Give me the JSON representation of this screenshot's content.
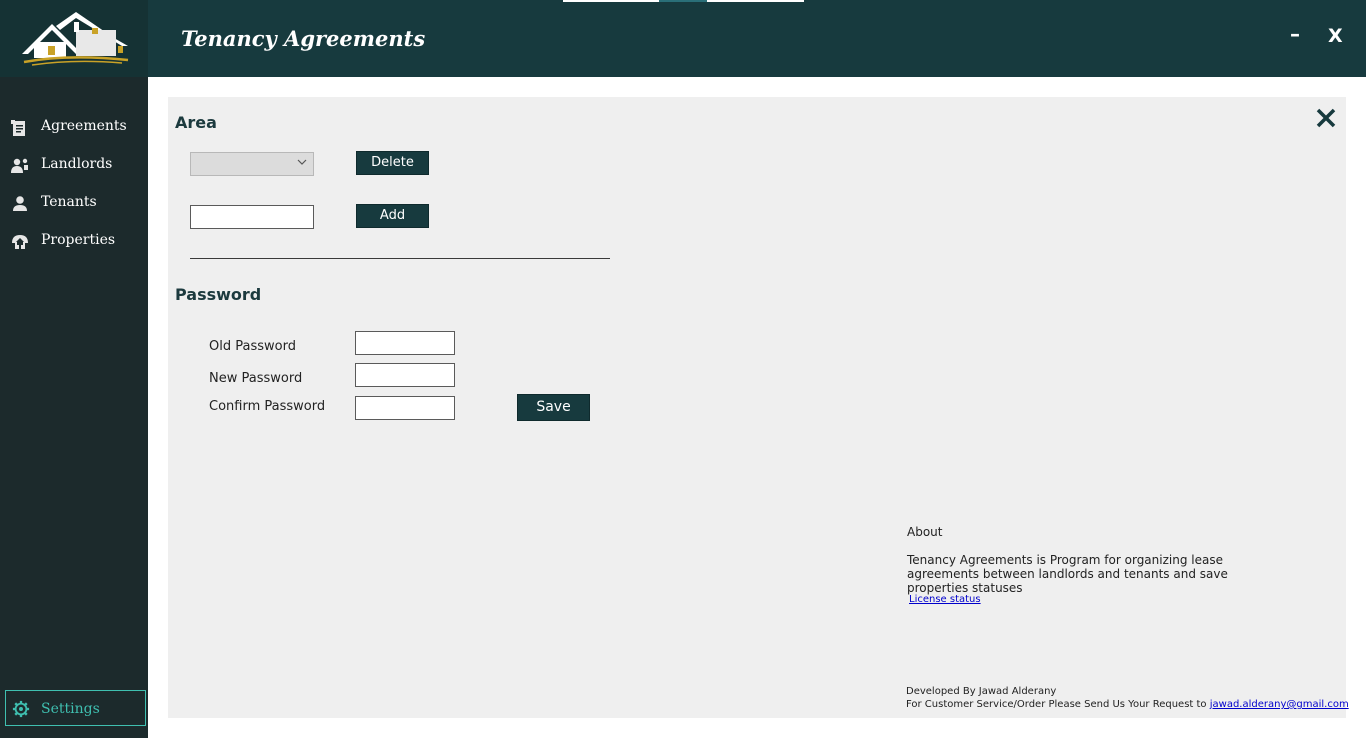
{
  "app": {
    "title": "Tenancy Agreements",
    "minimize_label": "–",
    "close_label": "X"
  },
  "sidebar": {
    "items": [
      {
        "label": "Agreements",
        "icon": "agreements-icon"
      },
      {
        "label": "Landlords",
        "icon": "landlords-icon"
      },
      {
        "label": "Tenants",
        "icon": "tenant-icon"
      },
      {
        "label": "Properties",
        "icon": "properties-icon"
      }
    ],
    "settings": {
      "label": "Settings",
      "icon": "gear-icon"
    }
  },
  "area": {
    "title": "Area",
    "select_value": "",
    "delete_label": "Delete",
    "new_area_value": "",
    "add_label": "Add"
  },
  "password": {
    "title": "Password",
    "old_label": "Old Password",
    "new_label": "New Password",
    "confirm_label": "Confirm Password",
    "save_label": "Save"
  },
  "about": {
    "label": "About",
    "text": "Tenancy Agreements is Program for organizing lease agreements between landlords and tenants and save properties statuses",
    "license_link": "License status"
  },
  "footer": {
    "developer": "Developed By Jawad Alderany",
    "contact_prefix": "For Customer Service/Order Please Send Us Your Request to ",
    "email": "jawad.alderany@gmail.com"
  },
  "colors": {
    "header_bg": "#173a3e",
    "sidebar_bg": "#1c2a2c",
    "accent": "#3fbfb0",
    "button_bg": "#173a3e",
    "panel_bg": "#efefef"
  }
}
